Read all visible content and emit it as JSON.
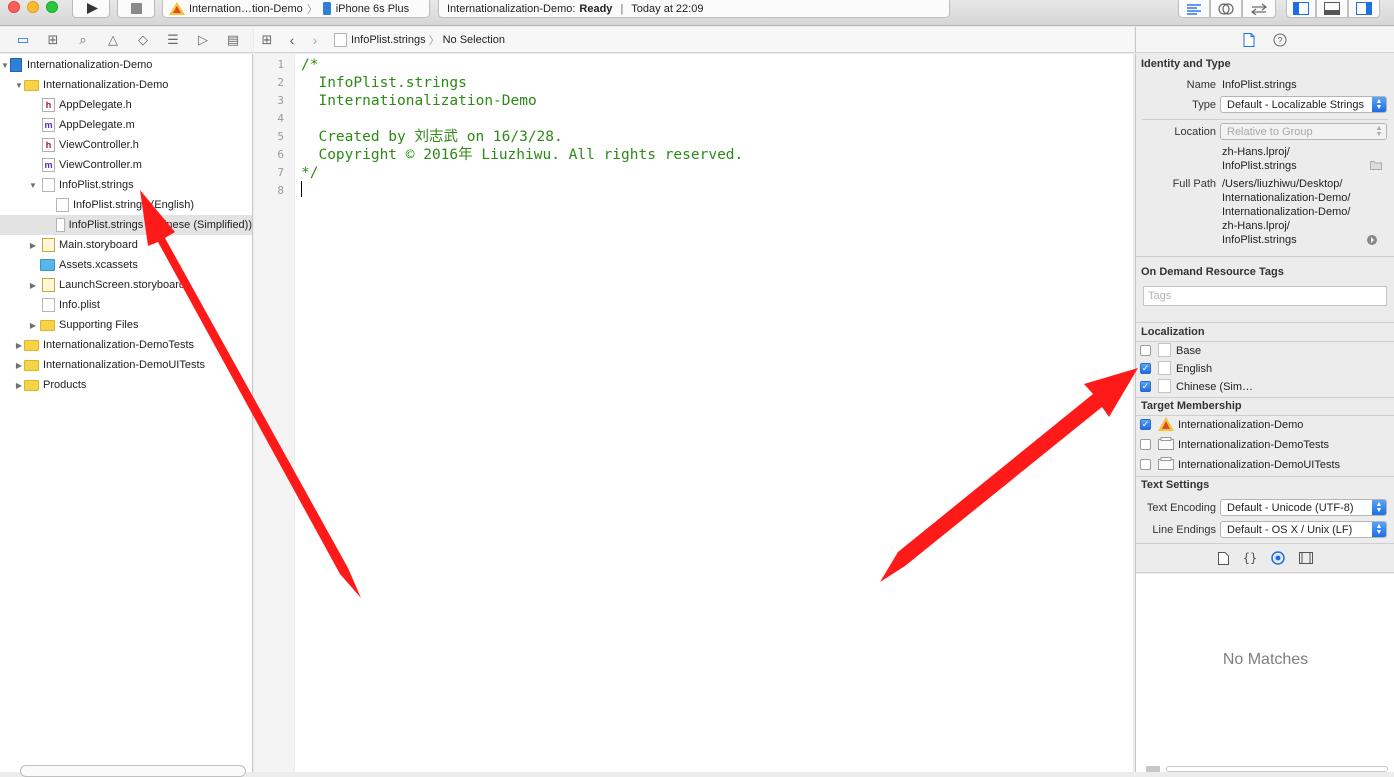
{
  "toolbar": {
    "scheme_name": "Internation…tion-Demo",
    "device": "iPhone 6s Plus",
    "status_project": "Internationalization-Demo:",
    "status_state": "Ready",
    "status_sep": "|",
    "status_time": "Today at 22:09"
  },
  "navigator": {
    "items": [
      {
        "label": "Internationalization-Demo"
      },
      {
        "label": "Internationalization-Demo"
      },
      {
        "label": "AppDelegate.h",
        "badge": "h"
      },
      {
        "label": "AppDelegate.m",
        "badge": "m"
      },
      {
        "label": "ViewController.h",
        "badge": "h"
      },
      {
        "label": "ViewController.m",
        "badge": "m"
      },
      {
        "label": "InfoPlist.strings"
      },
      {
        "label": "InfoPlist.strings (English)"
      },
      {
        "label": "InfoPlist.strings (Chinese (Simplified))"
      },
      {
        "label": "Main.storyboard"
      },
      {
        "label": "Assets.xcassets"
      },
      {
        "label": "LaunchScreen.storyboard"
      },
      {
        "label": "Info.plist"
      },
      {
        "label": "Supporting Files"
      },
      {
        "label": "Internationalization-DemoTests"
      },
      {
        "label": "Internationalization-DemoUITests"
      },
      {
        "label": "Products"
      }
    ]
  },
  "jumpbar": {
    "file": "InfoPlist.strings",
    "selection": "No Selection"
  },
  "editor": {
    "line_numbers": [
      "1",
      "2",
      "3",
      "4",
      "5",
      "6",
      "7",
      "8"
    ],
    "lines": [
      "/*",
      "  InfoPlist.strings",
      "  Internationalization-Demo",
      "",
      "  Created by 刘志武 on 16/3/28.",
      "  Copyright © 2016年 Liuzhiwu. All rights reserved.",
      "*/",
      ""
    ]
  },
  "inspector": {
    "identity": {
      "header": "Identity and Type",
      "name_label": "Name",
      "name_value": "InfoPlist.strings",
      "type_label": "Type",
      "type_value": "Default - Localizable Strings",
      "location_label": "Location",
      "location_value": "Relative to Group",
      "location_path_1": "zh-Hans.lproj/",
      "location_path_2": "InfoPlist.strings",
      "fullpath_label": "Full Path",
      "fullpath_lines": [
        "/Users/liuzhiwu/Desktop/",
        "Internationalization-Demo/",
        "Internationalization-Demo/",
        "zh-Hans.lproj/",
        "InfoPlist.strings"
      ]
    },
    "odr": {
      "header": "On Demand Resource Tags",
      "tags_placeholder": "Tags"
    },
    "localization": {
      "header": "Localization",
      "items": [
        {
          "label": "Base",
          "checked": false
        },
        {
          "label": "English",
          "checked": true
        },
        {
          "label": "Chinese (Sim…",
          "checked": true
        }
      ]
    },
    "target": {
      "header": "Target Membership",
      "items": [
        {
          "label": "Internationalization-Demo",
          "checked": true
        },
        {
          "label": "Internationalization-DemoTests",
          "checked": false
        },
        {
          "label": "Internationalization-DemoUITests",
          "checked": false
        }
      ]
    },
    "text_settings": {
      "header": "Text Settings",
      "encoding_label": "Text Encoding",
      "encoding_value": "Default - Unicode (UTF-8)",
      "line_endings_label": "Line Endings",
      "line_endings_value": "Default - OS X / Unix (LF)"
    },
    "library": {
      "empty_text": "No Matches"
    }
  },
  "colors": {
    "code": "#2c8a15",
    "accent": "#1d6fe3",
    "annotation_arrow": "#ff1a1a"
  }
}
